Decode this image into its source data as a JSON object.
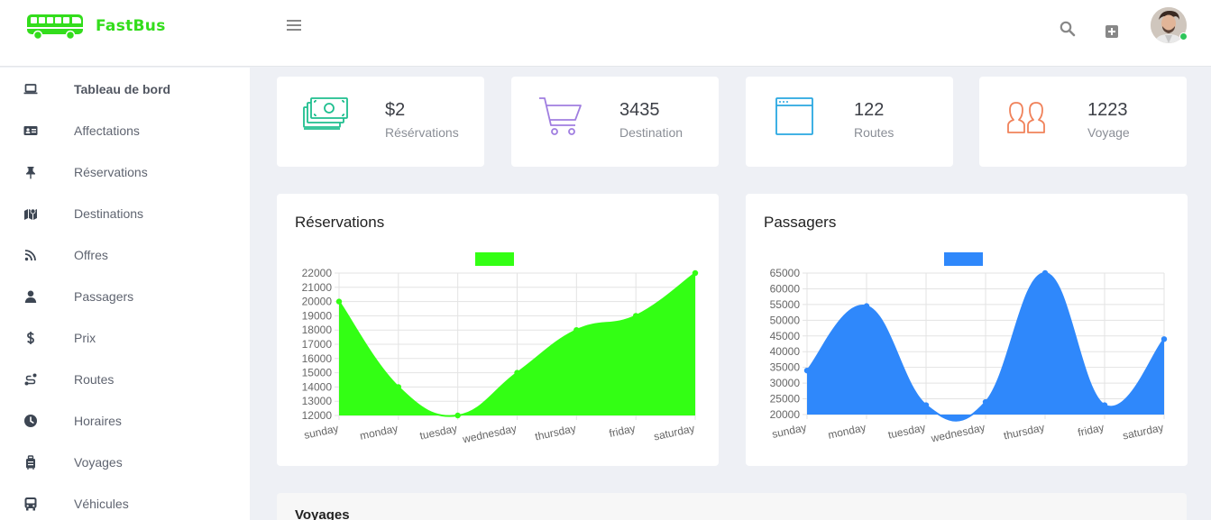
{
  "brand": {
    "name": "FastBus",
    "color": "#33dd1c"
  },
  "topbar": {
    "menu_icon": "hamburger-icon",
    "search_icon": "search-icon",
    "add_icon": "plus-square-icon",
    "avatar_icon": "user-avatar"
  },
  "sidebar": {
    "items": [
      {
        "label": "Tableau de bord",
        "icon": "laptop-icon",
        "active": true
      },
      {
        "label": "Affectations",
        "icon": "id-card-icon"
      },
      {
        "label": "Réservations",
        "icon": "thumbtack-icon"
      },
      {
        "label": "Destinations",
        "icon": "map-icon"
      },
      {
        "label": "Offres",
        "icon": "rss-icon"
      },
      {
        "label": "Passagers",
        "icon": "user-icon"
      },
      {
        "label": "Prix",
        "icon": "dollar-icon"
      },
      {
        "label": "Routes",
        "icon": "route-icon"
      },
      {
        "label": "Horaires",
        "icon": "clock-icon"
      },
      {
        "label": "Voyages",
        "icon": "suitcase-icon"
      },
      {
        "label": "Véhicules",
        "icon": "bus-icon"
      }
    ]
  },
  "stats": [
    {
      "value": "$2",
      "label": "Résérvations",
      "icon": "money-icon",
      "color": "#1fbf8f"
    },
    {
      "value": "3435",
      "label": "Destination",
      "icon": "cart-icon",
      "color": "#a07ee0"
    },
    {
      "value": "122",
      "label": "Routes",
      "icon": "browser-window-icon",
      "color": "#29a7e1"
    },
    {
      "value": "1223",
      "label": "Voyage",
      "icon": "users-icon",
      "color": "#f0825a"
    }
  ],
  "chart_data": [
    {
      "type": "area",
      "title": "Réservations",
      "color": "#33ff14",
      "legend": "top",
      "grid": true,
      "categories": [
        "sunday",
        "monday",
        "tuesday",
        "wednesday",
        "thursday",
        "friday",
        "saturday"
      ],
      "series": [
        {
          "values": [
            20000,
            14000,
            12000,
            15000,
            18000,
            19000,
            22000
          ]
        }
      ],
      "ylim": [
        12000,
        22000
      ],
      "yticks": [
        "22000",
        "21000",
        "20000",
        "19000",
        "18000",
        "17000",
        "16000",
        "15000",
        "14000",
        "13000",
        "12000"
      ]
    },
    {
      "type": "area",
      "title": "Passagers",
      "color": "#2f88fb",
      "legend": "top",
      "grid": true,
      "categories": [
        "sunday",
        "monday",
        "tuesday",
        "wednesday",
        "thursday",
        "friday",
        "saturday"
      ],
      "series": [
        {
          "values": [
            34000,
            54500,
            23000,
            24000,
            65000,
            23000,
            44000
          ]
        }
      ],
      "ylim": [
        20000,
        65000
      ],
      "yticks": [
        "65000",
        "60000",
        "55000",
        "50000",
        "45000",
        "40000",
        "35000",
        "30000",
        "25000",
        "20000"
      ]
    }
  ],
  "sections": {
    "voyages_title": "Voyages"
  }
}
